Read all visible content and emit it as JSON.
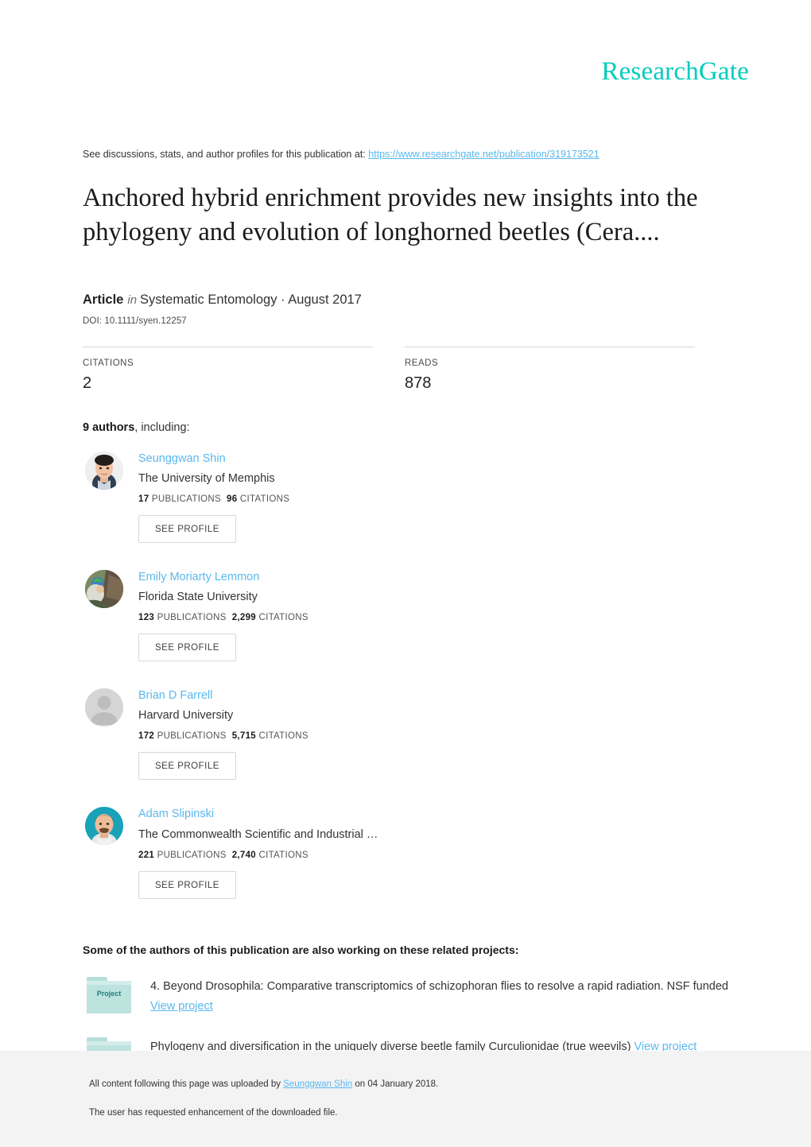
{
  "brand": {
    "logo_text": "ResearchGate",
    "accent_color": "#00ccbb",
    "link_color": "#5ab8ef"
  },
  "discussion": {
    "prefix": "See discussions, stats, and author profiles for this publication at: ",
    "url": "https://www.researchgate.net/publication/319173521"
  },
  "publication": {
    "title": "Anchored hybrid enrichment provides new insights into the phylogeny and evolution of longhorned beetles (Cera....",
    "type_label": "Article",
    "in_label": "in",
    "venue": "Systematic Entomology · August 2017",
    "doi": "DOI: 10.1111/syen.12257"
  },
  "stats": {
    "citations_label": "CITATIONS",
    "citations_value": "2",
    "reads_label": "READS",
    "reads_value": "878"
  },
  "authors_section": {
    "count_text": "9 authors",
    "suffix_text": ", including:",
    "see_profile_label": "SEE PROFILE",
    "publications_label": "PUBLICATIONS",
    "citations_label": "CITATIONS",
    "authors": [
      {
        "name": "Seunggwan Shin",
        "affiliation": "The University of Memphis",
        "publications": "17",
        "citations": "96",
        "avatar": "photo-portrait-male-lightbg"
      },
      {
        "name": "Emily Moriarty Lemmon",
        "affiliation": "Florida State University",
        "publications": "123",
        "citations": "2,299",
        "avatar": "photo-portrait-outdoors"
      },
      {
        "name": "Brian D Farrell",
        "affiliation": "Harvard University",
        "publications": "172",
        "citations": "5,715",
        "avatar": "placeholder-person-icon"
      },
      {
        "name": "Adam Slipinski",
        "affiliation": "The Commonwealth Scientific and Industrial …",
        "publications": "221",
        "citations": "2,740",
        "avatar": "photo-portrait-male-tealbg"
      }
    ]
  },
  "projects_section": {
    "heading": "Some of the authors of this publication are also working on these related projects:",
    "icon_label": "Project",
    "projects": [
      {
        "text": "4. Beyond Drosophila: Comparative transcriptomics of schizophoran flies to resolve a rapid radiation. NSF funded ",
        "link_text": "View project"
      },
      {
        "text": "Phylogeny and diversification in the uniquely diverse beetle family Curculionidae (true weevils) ",
        "link_text": "View project"
      }
    ]
  },
  "footer": {
    "line1_prefix": "All content following this page was uploaded by ",
    "line1_link": "Seunggwan Shin",
    "line1_suffix": " on 04 January 2018.",
    "line2": "The user has requested enhancement of the downloaded file."
  }
}
